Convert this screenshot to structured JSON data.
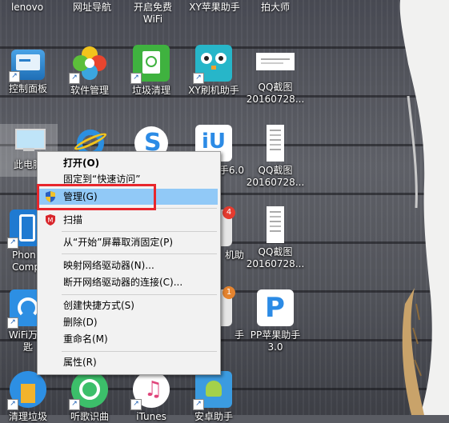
{
  "top_row": [
    {
      "label": "lenovo"
    },
    {
      "label": "网址导航"
    },
    {
      "label": "开启免费\nWiFi"
    },
    {
      "label": "XY苹果助手"
    },
    {
      "label": "拍大师"
    }
  ],
  "desktop_icons": [
    {
      "label": "控制面板"
    },
    {
      "label": "软件管理"
    },
    {
      "label": "垃圾清理"
    },
    {
      "label": "XY刷机助手"
    },
    {
      "label": "QQ截图\n20160728..."
    },
    {
      "label": "此电脑"
    },
    {
      "label": "手6.0"
    },
    {
      "label": "QQ截图\n20160728..."
    },
    {
      "label": "Phon\nCompa"
    },
    {
      "label": "机助"
    },
    {
      "label": "QQ截图\n20160728..."
    },
    {
      "label": "WiFi万能\n匙"
    },
    {
      "label": "手"
    },
    {
      "label": "PP苹果助手\n3.0"
    },
    {
      "label": "清理垃圾"
    },
    {
      "label": "听歌识曲"
    },
    {
      "label": "iTunes"
    },
    {
      "label": "安卓助手"
    }
  ],
  "badges": {
    "badge_4": "4",
    "badge_1": "1"
  },
  "context_menu": {
    "open": "打开(O)",
    "pin_quick_access": "固定到“快速访问”",
    "manage": "管理(G)",
    "scan": "扫描",
    "unpin_start": "从“开始”屏幕取消固定(P)",
    "map_drive": "映射网络驱动器(N)...",
    "disconnect_drive": "断开网络驱动器的连接(C)...",
    "create_shortcut": "创建快捷方式(S)",
    "delete": "删除(D)",
    "rename": "重命名(M)",
    "properties": "属性(R)"
  },
  "colors": {
    "highlight": "#91c9f7",
    "annotation_box": "#e8262c",
    "menu_bg": "#f2f2f2"
  }
}
